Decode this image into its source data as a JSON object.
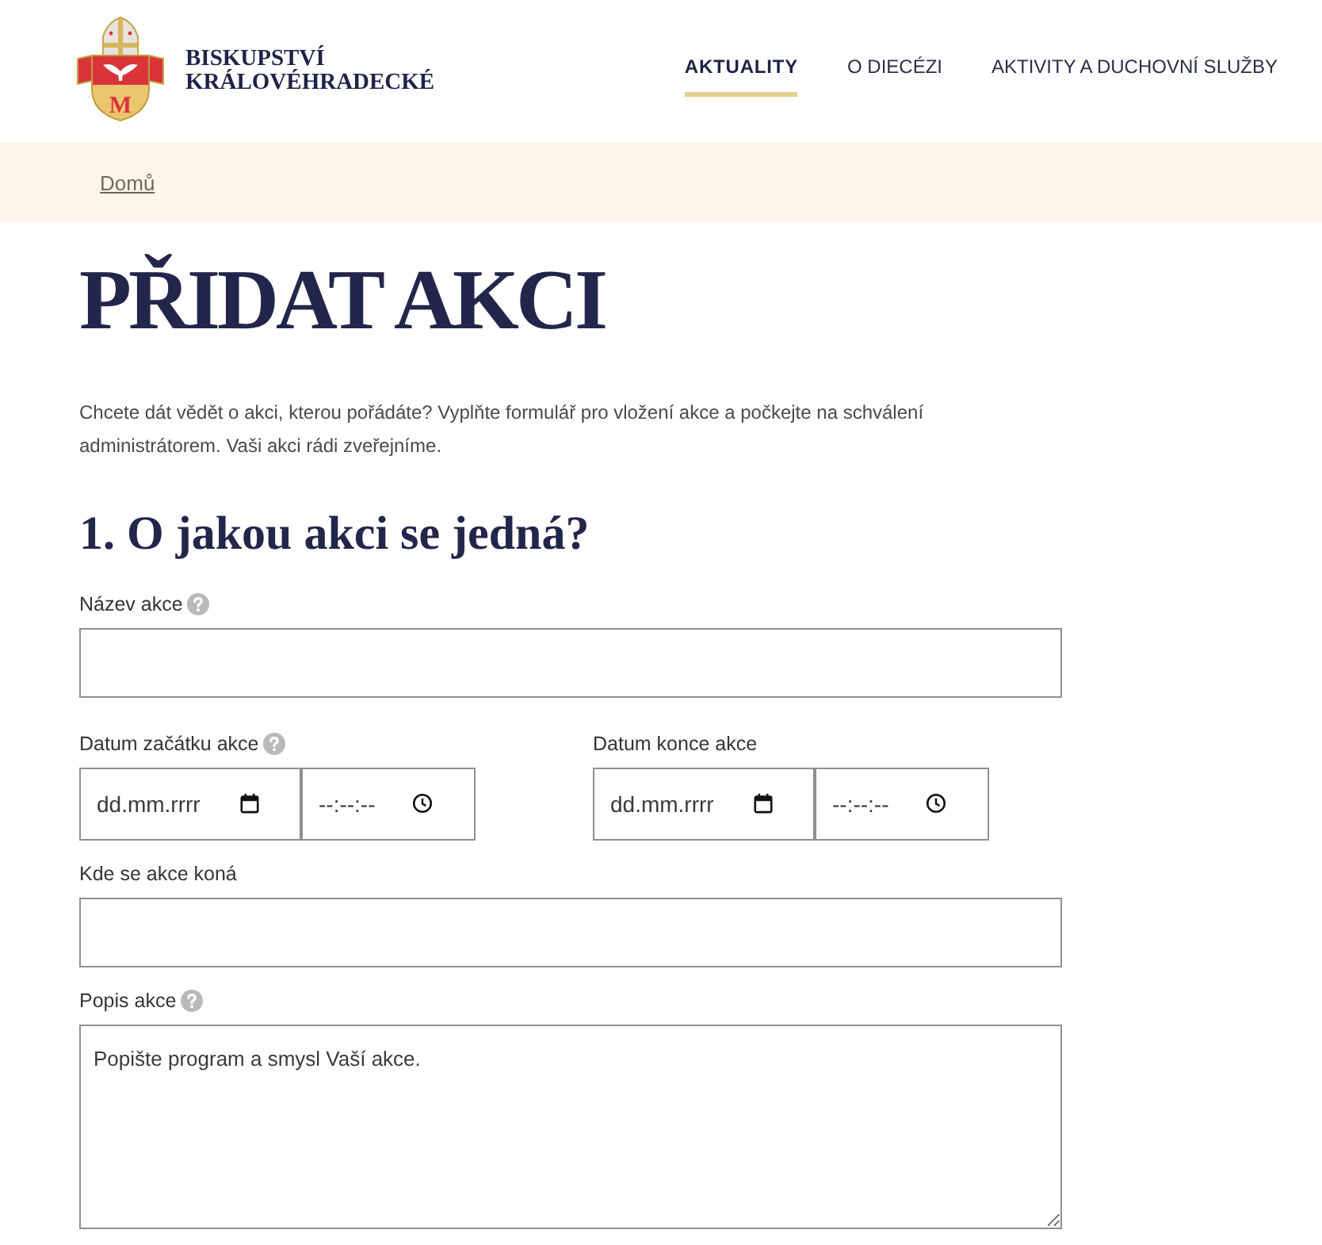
{
  "header": {
    "logo": {
      "monogram": "M"
    },
    "site_name": [
      "BISKUPSTVÍ",
      "KRÁLOVÉHRADECKÉ"
    ],
    "nav": [
      {
        "label": "AKTUALITY",
        "selected": true
      },
      {
        "label": "O DIECÉZI",
        "selected": false
      },
      {
        "label": "AKTIVITY A DUCHOVNÍ SLUŽBY",
        "selected": false
      }
    ]
  },
  "breadcrumb": [
    {
      "label": "Domů"
    }
  ],
  "page_title": "PŘIDAT AKCI",
  "intro": "Chcete dát vědět o akci, kterou pořádáte? Vyplňte formulář pro vložení akce a počkejte na schválení administrátorem. Vaši akci rádi zveřejníme.",
  "section": {
    "title": "1. O jakou akci se jedná?",
    "fields": [
      {
        "kind": "text",
        "label": "Název akce",
        "help": true
      },
      {
        "kind": "datetime_pair",
        "items": [
          {
            "label": "Datum začátku akce",
            "help": true,
            "date_placeholder": "dd.mm.rrrr",
            "time_placeholder": "--:--:--"
          },
          {
            "label": "Datum konce akce",
            "help": false,
            "date_placeholder": "dd.mm.rrrr",
            "time_placeholder": "--:--:--"
          }
        ]
      },
      {
        "kind": "text",
        "label": "Kde se akce koná",
        "help": false
      },
      {
        "kind": "textarea",
        "label": "Popis akce",
        "help": true,
        "placeholder": "Popište program a smysl Vaší akce."
      }
    ]
  }
}
